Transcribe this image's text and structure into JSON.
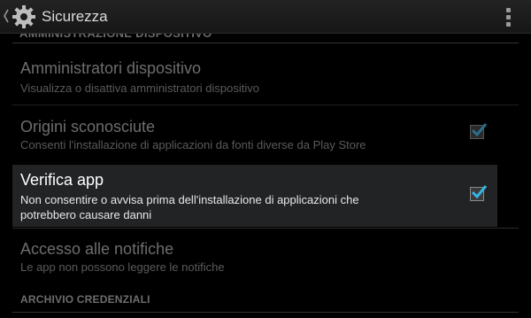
{
  "action_bar": {
    "title": "Sicurezza",
    "up_icon": "chevron-left-icon",
    "app_icon": "gear-icon",
    "overflow_icon": "more-vertical-icon"
  },
  "cut_header": "AMMINISTRAZIONE DISPOSITIVO",
  "items": [
    {
      "title": "Amministratori dispositivo",
      "summary": "Visualizza o disattiva amministratori dispositivo",
      "enabled": false
    },
    {
      "title": "Origini sconosciute",
      "summary": "Consenti l'installazione di applicazioni da fonti diverse da Play Store",
      "checked": true,
      "enabled": false
    },
    {
      "title": "Verifica app",
      "summary_line1": "Non consentire o avvisa prima dell'installazione di applicazioni che",
      "summary_line2": "potrebbero causare danni",
      "checked": true,
      "enabled": true
    },
    {
      "title": "Accesso alle notifiche",
      "summary": "Le app non possono leggere le notifiche",
      "enabled": false
    }
  ],
  "section_header": "ARCHIVIO CREDENZIALI",
  "colors": {
    "background": "#000000",
    "accent_check": "#33b5e5",
    "disabled_text": "#6d6d6d",
    "active_text": "#ffffff"
  }
}
